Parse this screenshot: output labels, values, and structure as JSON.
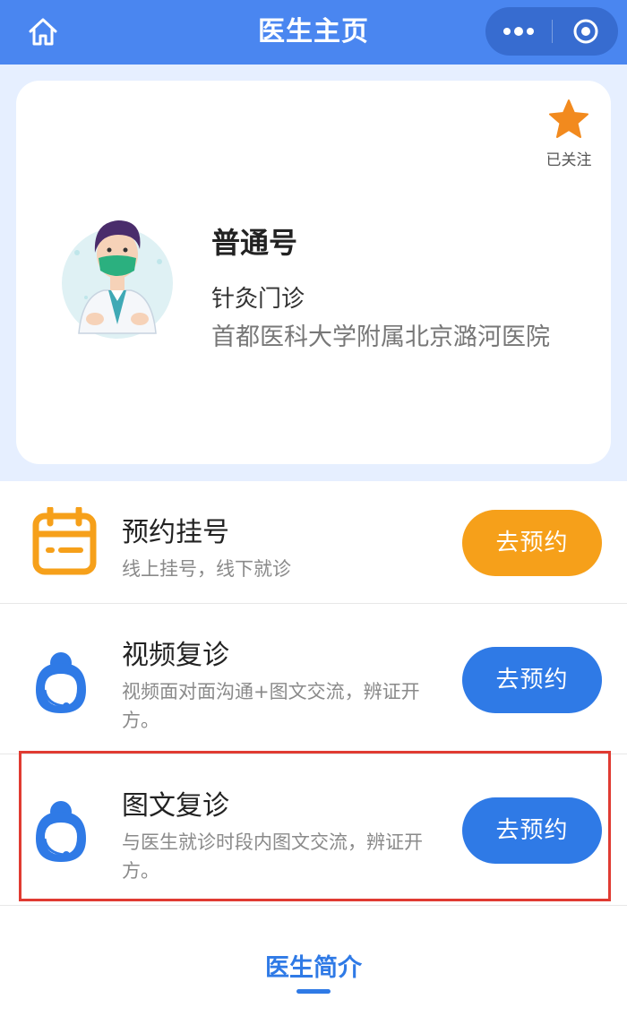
{
  "header": {
    "title": "医生主页",
    "home_icon": "home-icon",
    "more_icon": "more-dots-icon",
    "close_icon": "target-close-icon"
  },
  "doctor": {
    "follow_label": "已关注",
    "registration_type": "普通号",
    "department": "针灸门诊",
    "hospital": "首都医科大学附属北京潞河医院"
  },
  "services": [
    {
      "title": "预约挂号",
      "description": "线上挂号，线下就诊",
      "button_label": "去预约",
      "icon": "calendar-icon"
    },
    {
      "title": "视频复诊",
      "description": "视频面对面沟通+图文交流，辨证开方。",
      "button_label": "去预约",
      "icon": "headset-person-icon"
    },
    {
      "title": "图文复诊",
      "description": "与医生就诊时段内图文交流，辨证开方。",
      "button_label": "去预约",
      "icon": "headset-person-icon"
    }
  ],
  "tabs": {
    "intro_label": "医生简介"
  },
  "colors": {
    "header_bg": "#4a86f0",
    "accent_blue": "#2f7ae6",
    "orange": "#f6a01a",
    "highlight_red": "#e03b32",
    "band_bg": "#e6efff"
  }
}
